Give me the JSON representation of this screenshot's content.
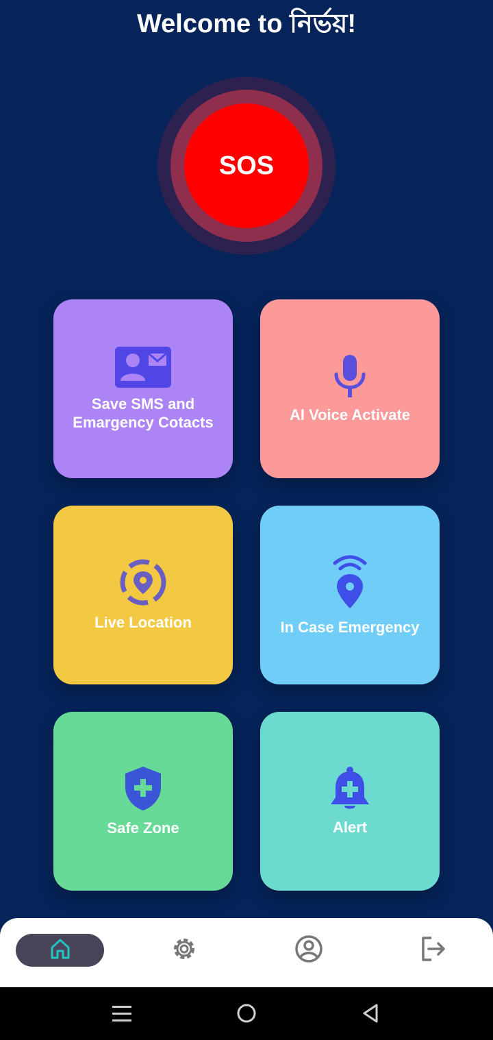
{
  "header": {
    "title": "Welcome to নির্ভয়!"
  },
  "sos": {
    "label": "SOS",
    "color": "#ff0000"
  },
  "cards": [
    {
      "label": "Save SMS and Emargency Cotacts",
      "icon": "contact-card-icon",
      "color": "#ad84f6"
    },
    {
      "label": "AI Voice Activate",
      "icon": "microphone-icon",
      "color": "#fc9a9a"
    },
    {
      "label": "Live Location",
      "icon": "location-target-icon",
      "color": "#f3c943"
    },
    {
      "label": "In Case Emergency",
      "icon": "location-signal-icon",
      "color": "#6fcdf8"
    },
    {
      "label": "Safe Zone",
      "icon": "shield-plus-icon",
      "color": "#67da97"
    },
    {
      "label": "Alert",
      "icon": "bell-plus-icon",
      "color": "#6cdacf"
    }
  ],
  "bottom_nav": {
    "items": [
      {
        "icon": "home-icon",
        "active": true
      },
      {
        "icon": "settings-gear-icon",
        "active": false
      },
      {
        "icon": "profile-icon",
        "active": false
      },
      {
        "icon": "logout-icon",
        "active": false
      }
    ]
  },
  "system_nav": {
    "buttons": [
      "menu-icon",
      "home-circle-icon",
      "back-triangle-icon"
    ]
  },
  "colors": {
    "background": "#06245a",
    "icon_accent": "#4f46e5",
    "nav_active_bg": "#4a4458",
    "nav_active_icon": "#22c3c3"
  }
}
